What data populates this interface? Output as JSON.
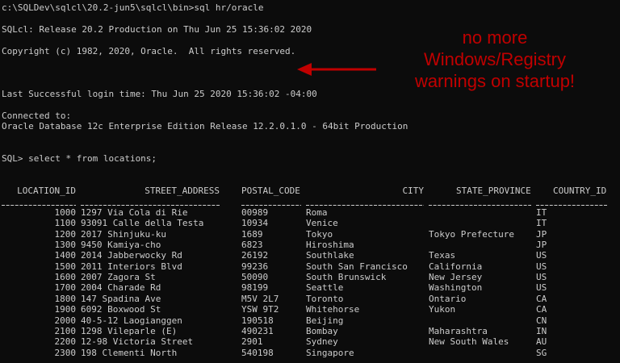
{
  "terminal": {
    "command_line": "c:\\SQLDev\\sqlcl\\20.2-jun5\\sqlcl\\bin>sql hr/oracle",
    "release_line": "SQLcl: Release 20.2 Production on Thu Jun 25 15:36:02 2020",
    "copyright_line": "Copyright (c) 1982, 2020, Oracle.  All rights reserved.",
    "last_login_line": "Last Successful login time: Thu Jun 25 2020 15:36:02 -04:00",
    "connected_label": "Connected to:",
    "db_version_line": "Oracle Database 12c Enterprise Edition Release 12.2.0.1.0 - 64bit Production",
    "query_line": "SQL> select * from locations;"
  },
  "annotation": {
    "lines": [
      "no more",
      "Windows/Registry",
      "warnings on startup!"
    ],
    "color": "#c00000"
  },
  "table": {
    "headers": {
      "location_id": "LOCATION_ID",
      "street_address": "STREET_ADDRESS",
      "postal_code": "POSTAL_CODE",
      "city": "CITY",
      "state_province": "STATE_PROVINCE",
      "country_id": "COUNTRY_ID"
    },
    "rows": [
      [
        "1000",
        "1297 Via Cola di Rie",
        "00989",
        "Roma",
        "",
        "IT"
      ],
      [
        "1100",
        "93091 Calle della Testa",
        "10934",
        "Venice",
        "",
        "IT"
      ],
      [
        "1200",
        "2017 Shinjuku-ku",
        "1689",
        "Tokyo",
        "Tokyo Prefecture",
        "JP"
      ],
      [
        "1300",
        "9450 Kamiya-cho",
        "6823",
        "Hiroshima",
        "",
        "JP"
      ],
      [
        "1400",
        "2014 Jabberwocky Rd",
        "26192",
        "Southlake",
        "Texas",
        "US"
      ],
      [
        "1500",
        "2011 Interiors Blvd",
        "99236",
        "South San Francisco",
        "California",
        "US"
      ],
      [
        "1600",
        "2007 Zagora St",
        "50090",
        "South Brunswick",
        "New Jersey",
        "US"
      ],
      [
        "1700",
        "2004 Charade Rd",
        "98199",
        "Seattle",
        "Washington",
        "US"
      ],
      [
        "1800",
        "147 Spadina Ave",
        "M5V 2L7",
        "Toronto",
        "Ontario",
        "CA"
      ],
      [
        "1900",
        "6092 Boxwood St",
        "YSW 9T2",
        "Whitehorse",
        "Yukon",
        "CA"
      ],
      [
        "2000",
        "40-5-12 Laogianggen",
        "190518",
        "Beijing",
        "",
        "CN"
      ],
      [
        "2100",
        "1298 Vileparle (E)",
        "490231",
        "Bombay",
        "Maharashtra",
        "IN"
      ],
      [
        "2200",
        "12-98 Victoria Street",
        "2901",
        "Sydney",
        "New South Wales",
        "AU"
      ],
      [
        "2300",
        "198 Clementi North",
        "540198",
        "Singapore",
        "",
        "SG"
      ]
    ]
  }
}
